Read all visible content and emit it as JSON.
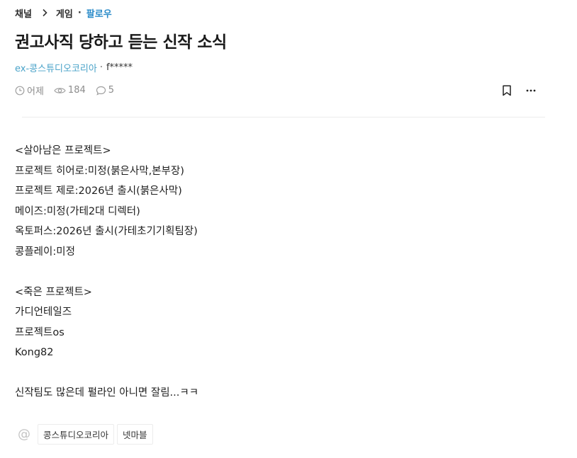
{
  "breadcrumb": {
    "channel": "채널",
    "board": "게임",
    "dot": "·",
    "follow": "팔로우"
  },
  "post": {
    "title": "권고사직 당하고 듣는 신작 소식",
    "channel_name": "ex-콩스튜디오코리아",
    "separator": "·",
    "author": "f*****",
    "time": "어제",
    "views": "184",
    "comments": "5"
  },
  "icons": {
    "clock": "clock-icon",
    "views": "eye-icon",
    "comments": "comment-icon",
    "bookmark": "bookmark-icon",
    "more": "more-icon",
    "mention": "at-icon"
  },
  "body_lines": [
    "<살아남은 프로젝트>",
    "프로젝트 히어로:미정(붉은사막,본부장)",
    "프로젝트 제로:2026년 출시(붉은사막)",
    "메이즈:미정(가테2대 디렉터)",
    "옥토퍼스:2026년 출시(가테초기기획팀장)",
    "콩플레이:미정",
    "",
    "<죽은 프로젝트>",
    "가디언테일즈",
    "프로젝트os",
    "Kong82",
    "",
    "신작팀도 많은데 펄라인 아니면 잘림...ㅋㅋ"
  ],
  "tags": {
    "at_symbol": "@",
    "items": [
      "콩스튜디오코리아",
      "넷마블"
    ]
  },
  "colors": {
    "follow": "#2a8bc9",
    "channel_link": "#4aa3c9",
    "meta_text": "#8c8c8c"
  }
}
